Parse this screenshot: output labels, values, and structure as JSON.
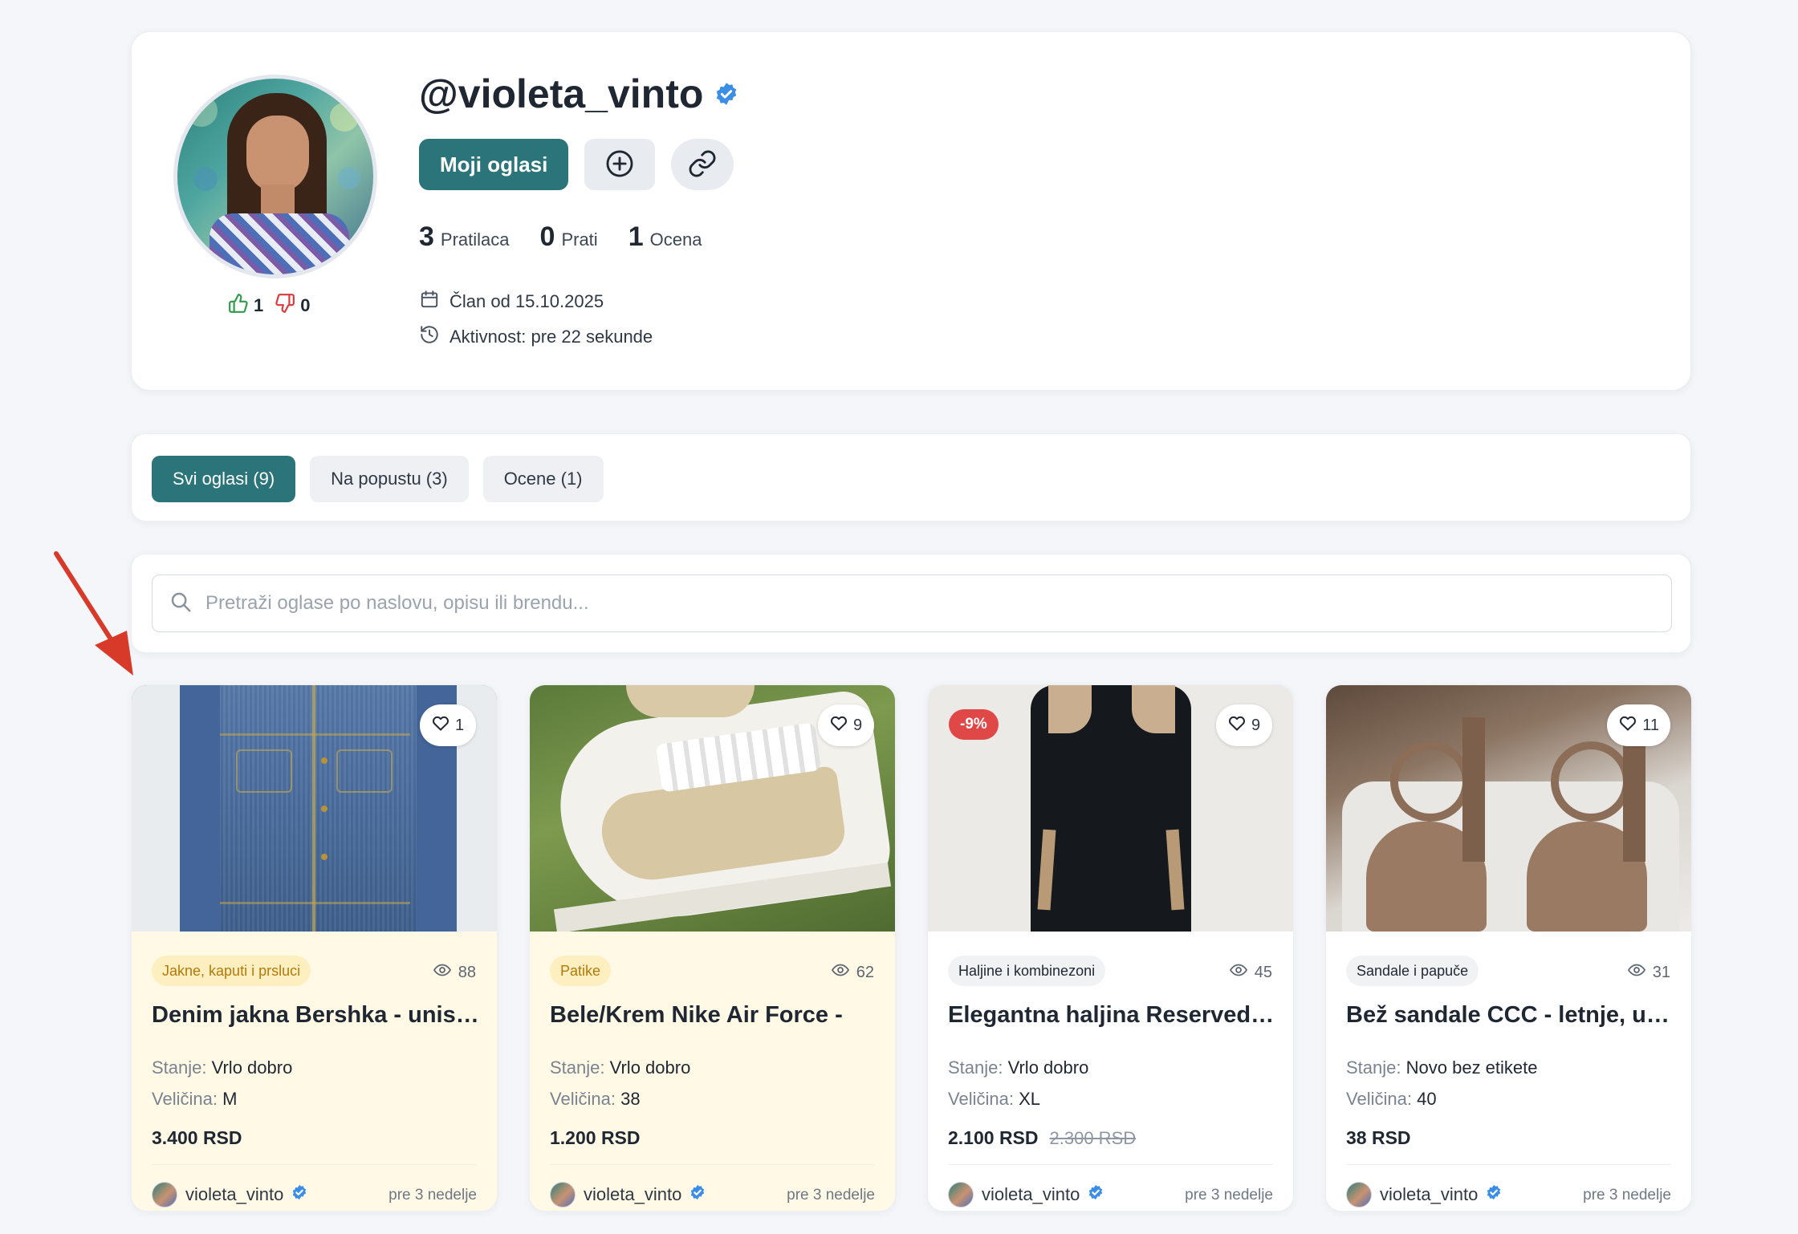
{
  "profile": {
    "username": "@violeta_vinto",
    "my_ads_label": "Moji oglasi",
    "likes": "1",
    "dislikes": "0",
    "stats": [
      {
        "value": "3",
        "label": "Pratilaca"
      },
      {
        "value": "0",
        "label": "Prati"
      },
      {
        "value": "1",
        "label": "Ocena"
      }
    ],
    "member_since": "Član od 15.10.2025",
    "activity": "Aktivnost: pre 22 sekunde"
  },
  "tabs": [
    {
      "label": "Svi oglasi (9)",
      "active": true
    },
    {
      "label": "Na popustu (3)",
      "active": false
    },
    {
      "label": "Ocene (1)",
      "active": false
    }
  ],
  "search": {
    "placeholder": "Pretraži oglase po naslovu, opisu ili brendu..."
  },
  "labels": {
    "condition": "Stanje:",
    "size": "Veličina:"
  },
  "listings": [
    {
      "favorites": "1",
      "category": "Jakne, kaputi i prsluci",
      "views": "88",
      "title": "Denim jakna Bershka - unisex",
      "condition": "Vrlo dobro",
      "size": "M",
      "price": "3.400 RSD",
      "old_price": "",
      "discount": "",
      "seller": "violeta_vinto",
      "time": "pre 3 nedelje"
    },
    {
      "favorites": "9",
      "category": "Patike",
      "views": "62",
      "title": "Bele/Krem Nike Air Force - ",
      "condition": "Vrlo dobro",
      "size": "38",
      "price": "1.200 RSD",
      "old_price": "",
      "discount": "",
      "seller": "violeta_vinto",
      "time": "pre 3 nedelje"
    },
    {
      "favorites": "9",
      "category": "Haljine i kombinezoni",
      "views": "45",
      "title": "Elegantna haljina Reserved crna",
      "condition": "Vrlo dobro",
      "size": "XL",
      "price": "2.100 RSD",
      "old_price": "2.300 RSD",
      "discount": "-9%",
      "seller": "violeta_vinto",
      "time": "pre 3 nedelje"
    },
    {
      "favorites": "11",
      "category": "Sandale i papuče",
      "views": "31",
      "title": "Bež sandale CCC - letnje, udobne",
      "condition": "Novo bez etikete",
      "size": "40",
      "price": "38 RSD",
      "old_price": "",
      "discount": "",
      "seller": "violeta_vinto",
      "time": "pre 3 nedelje"
    }
  ],
  "colors": {
    "accent": "#2b7479",
    "verified": "#3b8ee6",
    "discount": "#e04848",
    "annotation_arrow": "#d83a2a"
  }
}
